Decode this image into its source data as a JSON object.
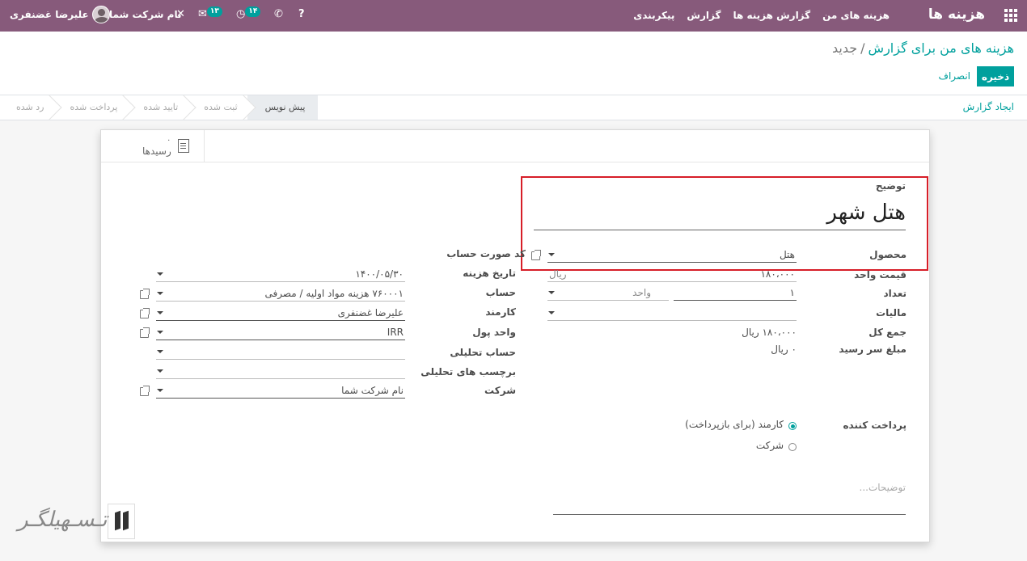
{
  "navbar": {
    "brand": "هزینه ها",
    "menu": [
      "هزینه های من",
      "گزارش هزینه ها",
      "گزارش",
      "پیکربندی"
    ],
    "activity_badge": "۱۴",
    "messages_badge": "۱۳",
    "company": "نام شرکت شما",
    "user": "علیرضا غضنفری",
    "help_icon": "?",
    "phone_icon": "✆",
    "tools_icon": "✕"
  },
  "breadcrumb": {
    "parent": "هزینه های من برای گزارش",
    "separator": "/",
    "current": "جدید"
  },
  "actions": {
    "save": "ذخیره",
    "discard": "انصراف"
  },
  "statusbar": {
    "create_report": "ایجاد گزارش",
    "stages": [
      "پیش نویس",
      "ثبت شده",
      "تایید شده",
      "پرداخت شده",
      "رد شده"
    ],
    "active_stage": "پیش نویس"
  },
  "smart_button": {
    "count": "۰",
    "label": "رسیدها"
  },
  "form": {
    "description_label": "توضیح",
    "description_value": "هتل شهر",
    "product_label": "محصول",
    "product_value": "هتل",
    "unit_price_label": "قیمت واحد",
    "unit_price_value": "۱۸۰،۰۰۰",
    "unit_price_currency": "ریال",
    "quantity_label": "تعداد",
    "quantity_value": "۱",
    "quantity_uom": "واحد",
    "taxes_label": "مالیات",
    "total_label": "جمع کل",
    "total_value": "۱۸۰،۰۰۰ ریال",
    "due_label": "مبلغ سر رسید",
    "due_value": "۰ ریال",
    "bill_ref_label": "کد صورت حساب",
    "date_label": "تاریخ هزینه",
    "date_value": "۱۴۰۰/۰۵/۳۰",
    "account_label": "حساب",
    "account_value": "۷۶۰۰۰۱ هزینه مواد اولیه / مصرفی",
    "employee_label": "کارمند",
    "employee_value": "علیرضا غضنفری",
    "currency_label": "واحد پول",
    "currency_value": "IRR",
    "analytic_account_label": "حساب تحلیلی",
    "analytic_tags_label": "برچسب های تحلیلی",
    "company_label": "شرکت",
    "company_value": "نام شرکت شما",
    "paid_by_label": "پرداخت کننده",
    "paid_by_options": [
      "کارمند (برای بازپرداخت)",
      "شرکت"
    ],
    "notes_placeholder": "توضیحات..."
  },
  "watermark": {
    "text": "تـسـهیلگـر"
  }
}
